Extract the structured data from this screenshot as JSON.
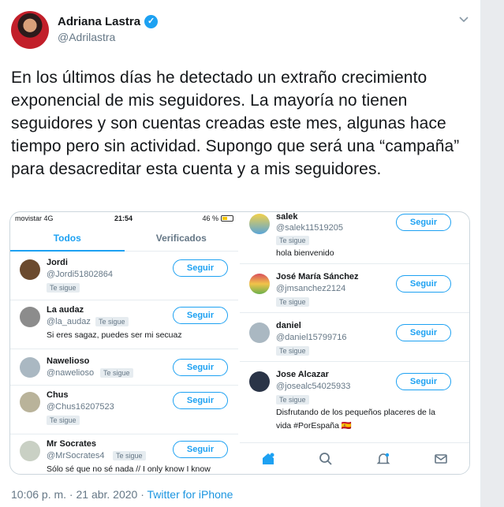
{
  "author": {
    "name": "Adriana Lastra",
    "handle": "@Adrilastra",
    "verified_glyph": "✓"
  },
  "tweet": {
    "text": "En los últimos días he detectado un extraño crecimiento exponencial de mis seguidores. La mayoría no tienen seguidores y son cuentas creadas este mes, algunas hace tiempo pero sin actividad. Supongo que será una “campaña” para desacreditar esta cuenta y a mis seguidores.",
    "timestamp": "10:06 p. m. · 21 abr. 2020 · ",
    "source": "Twitter for iPhone"
  },
  "phone_left": {
    "status": {
      "carrier": "movistar  4G",
      "time": "21:54",
      "battery": "46 %"
    },
    "tabs": [
      "Todos",
      "Verificados"
    ],
    "users": [
      {
        "name": "Jordi",
        "handle": "@Jordi51802864",
        "badge": "Te sigue",
        "bio": "",
        "button": "Seguir"
      },
      {
        "name": "La audaz",
        "handle": "@la_audaz",
        "badge": "Te sigue",
        "bio": "Si eres sagaz, puedes ser mi secuaz",
        "button": "Seguir"
      },
      {
        "name": "Nawelioso",
        "handle": "@nawelioso",
        "badge": "Te sigue",
        "bio": "",
        "button": "Seguir"
      },
      {
        "name": "Chus",
        "handle": "@Chus16207523",
        "badge": "Te sigue",
        "bio": "",
        "button": "Seguir"
      },
      {
        "name": "Mr Socrates",
        "handle": "@MrSocrates4",
        "badge": "Te sigue",
        "bio": "Sólo sé que no sé nada // I only know I know",
        "button": "Seguir"
      }
    ]
  },
  "phone_right": {
    "users": [
      {
        "name": "salek",
        "handle": "@salek11519205",
        "badge": "Te sigue",
        "bio": "hola bienvenido",
        "button": "Seguir"
      },
      {
        "name": "José María Sánchez",
        "handle": "@jmsanchez2124",
        "badge": "Te sigue",
        "bio": "",
        "button": "Seguir"
      },
      {
        "name": "daniel",
        "handle": "@daniel15799716",
        "badge": "Te sigue",
        "bio": "",
        "button": "Seguir"
      },
      {
        "name": "Jose Alcazar",
        "handle": "@josealc54025933",
        "badge": "Te sigue",
        "bio": "Disfrutando de los pequeños placeres de la",
        "bio2": "vida #PorEspaña 🇪🇸",
        "button": "Seguir"
      }
    ],
    "nav_icons": [
      "home-icon",
      "search-icon",
      "notifications-icon",
      "messages-icon"
    ]
  },
  "colors": {
    "accent": "#1da1f2",
    "muted": "#657786",
    "text": "#14171a"
  }
}
